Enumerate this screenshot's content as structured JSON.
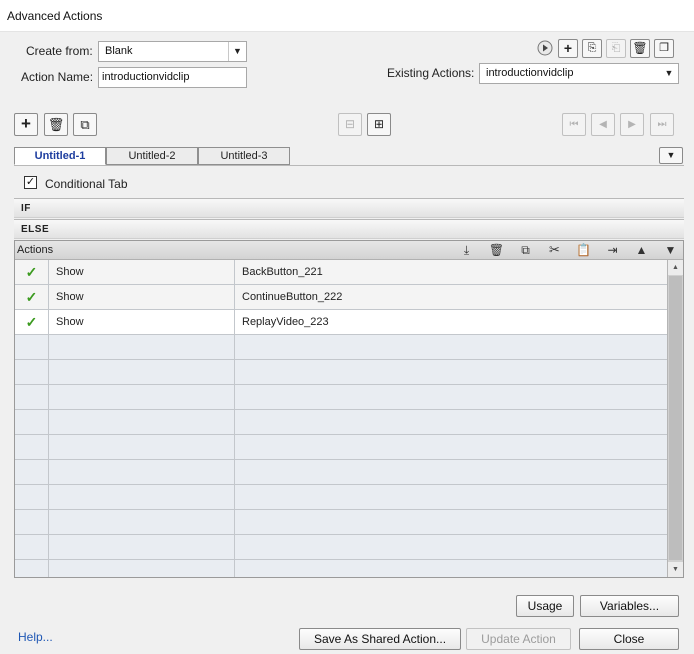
{
  "window": {
    "title": "Advanced Actions"
  },
  "form": {
    "create_from_label": "Create from:",
    "create_from_value": "Blank",
    "action_name_label": "Action Name:",
    "action_name_value": "introductionvidclip",
    "existing_actions_label": "Existing Actions:",
    "existing_actions_value": "introductionvidclip"
  },
  "top_toolbar": {
    "icons": [
      "preview-play-icon",
      "add-action-icon",
      "import-icon",
      "export-icon",
      "delete-action-icon",
      "duplicate-action-icon"
    ]
  },
  "decision_toolbar": {
    "left_icons": [
      "add-decision-icon",
      "delete-decision-icon",
      "duplicate-decision-icon"
    ],
    "center_icons": [
      "insert-before-icon",
      "insert-after-icon"
    ],
    "nav_icons": [
      "first-icon",
      "previous-icon",
      "next-icon",
      "last-icon"
    ]
  },
  "tabs": [
    {
      "label": "Untitled-1",
      "active": true
    },
    {
      "label": "Untitled-2",
      "active": false
    },
    {
      "label": "Untitled-3",
      "active": false
    }
  ],
  "conditional": {
    "label": "Conditional Tab",
    "checked": true,
    "checkmark": "✓"
  },
  "sections": {
    "if_label": "IF",
    "else_label": "ELSE"
  },
  "actions": {
    "header_label": "Actions",
    "toolbar_icons": [
      "insert-row-icon",
      "delete-row-icon",
      "copy-row-icon",
      "cut-icon",
      "paste-icon",
      "insert-after-row-icon",
      "move-up-icon",
      "move-down-icon"
    ],
    "rows": [
      {
        "status": "✓",
        "action": "Show",
        "target": "BackButton_221"
      },
      {
        "status": "✓",
        "action": "Show",
        "target": "ContinueButton_222"
      },
      {
        "status": "✓",
        "action": "Show",
        "target": "ReplayVideo_223"
      }
    ],
    "selected_row": 2,
    "empty_rows": 10
  },
  "buttons": {
    "usage": "Usage",
    "variables": "Variables...",
    "help": "Help...",
    "save_shared": "Save As Shared Action...",
    "update_action": "Update Action",
    "close": "Close"
  },
  "colors": {
    "check_green": "#3b9a1f",
    "link_blue": "#1f57b4",
    "active_tab_text": "#1d3d9f"
  }
}
